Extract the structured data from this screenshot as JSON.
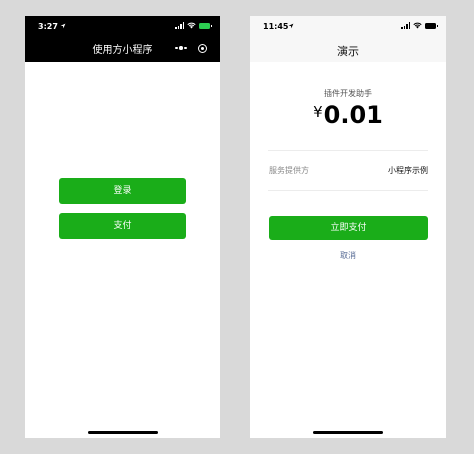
{
  "left_phone": {
    "status": {
      "time": "3:27"
    },
    "navbar": {
      "title": "使用方小程序"
    },
    "buttons": {
      "login": "登录",
      "pay": "支付"
    }
  },
  "right_phone": {
    "status": {
      "time": "11:45"
    },
    "navbar": {
      "title": "演示"
    },
    "payment": {
      "merchant": "插件开发助手",
      "currency": "¥",
      "amount": "0.01",
      "provider_label": "服务提供方",
      "provider_value": "小程序示例",
      "pay_button": "立即支付",
      "cancel": "取消"
    }
  },
  "colors": {
    "primary_green": "#1aad19",
    "link_blue": "#576b95",
    "battery_green": "#2dcd52"
  },
  "icons": [
    "signal-icon",
    "wifi-icon",
    "battery-icon",
    "location-arrow-icon",
    "more-icon",
    "target-icon"
  ]
}
